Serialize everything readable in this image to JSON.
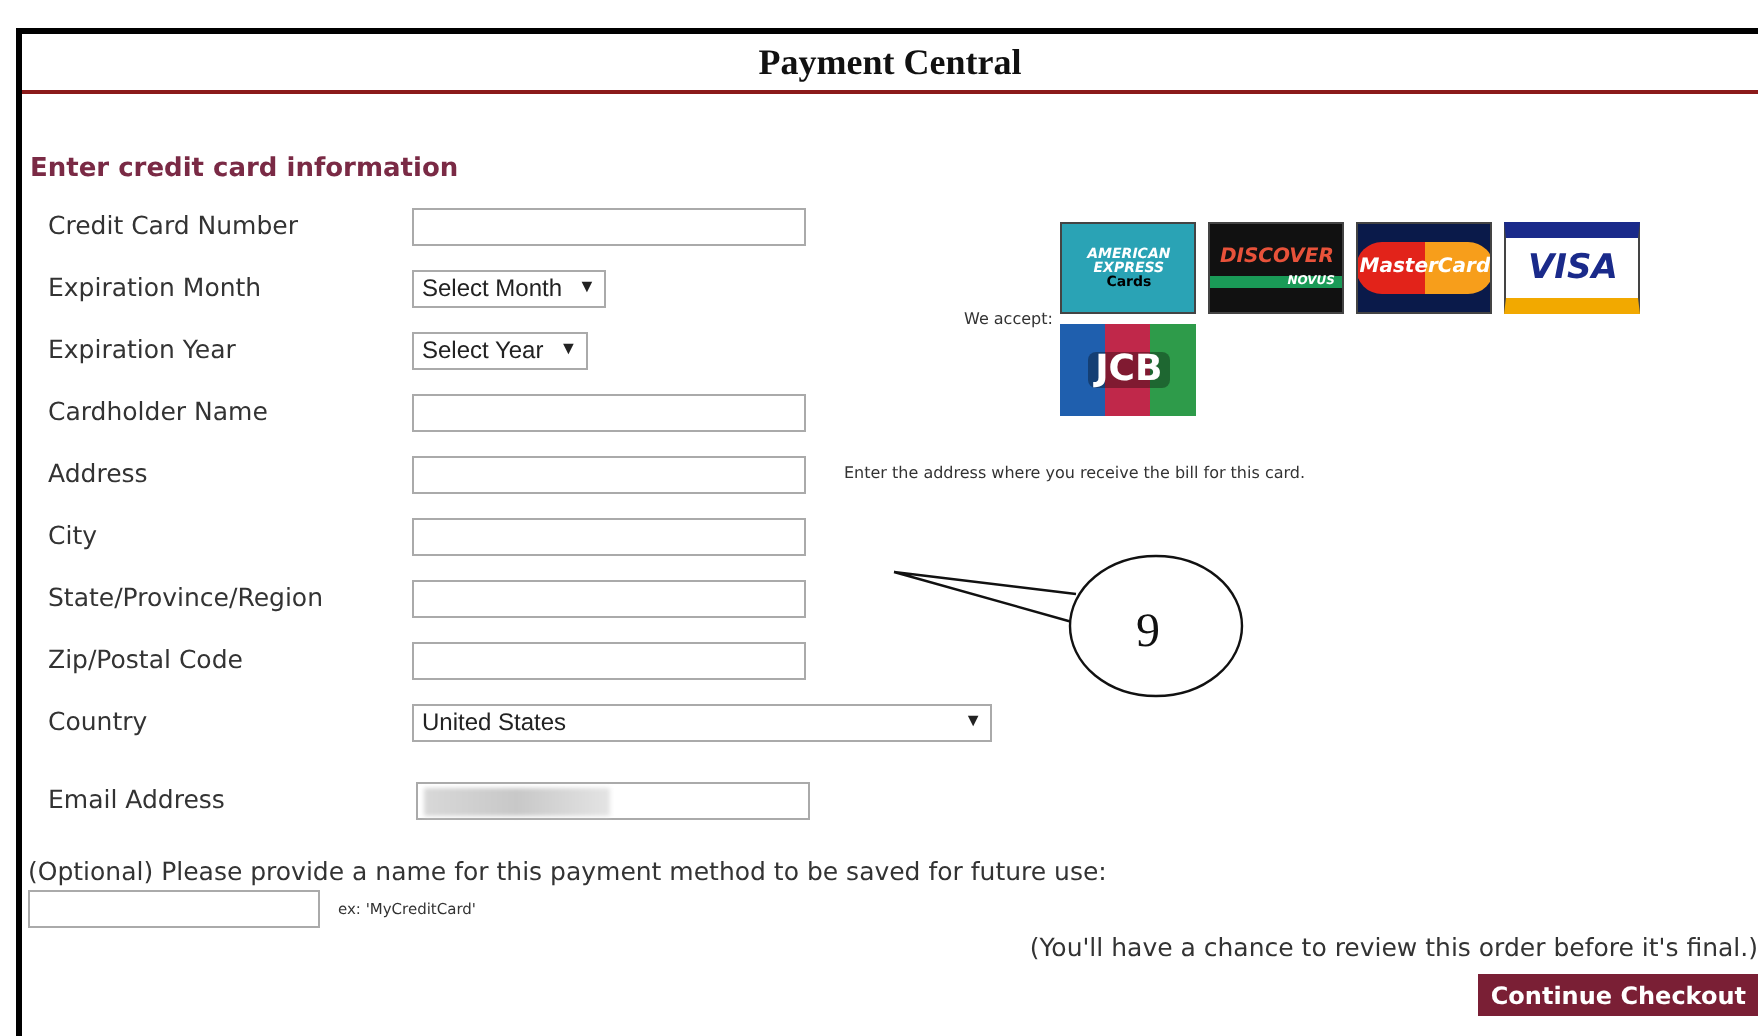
{
  "title": "Payment Central",
  "section_heading": "Enter credit card information",
  "fields": [
    {
      "label": "Credit Card Number",
      "kind": "text"
    },
    {
      "label": "Expiration Month",
      "kind": "select",
      "value": "Select Month",
      "arrow": "▼"
    },
    {
      "label": "Expiration Year",
      "kind": "select",
      "value": "Select Year",
      "arrow": "▼"
    },
    {
      "label": "Cardholder Name",
      "kind": "text"
    },
    {
      "label": "Address",
      "kind": "text",
      "hint": "Enter the address where you receive the bill for this card."
    },
    {
      "label": "City",
      "kind": "text"
    },
    {
      "label": "State/Province/Region",
      "kind": "text"
    },
    {
      "label": "Zip/Postal Code",
      "kind": "text"
    },
    {
      "label": "Country",
      "kind": "wide-select",
      "value": "United States",
      "arrow": "▼"
    }
  ],
  "email": {
    "label": "Email Address",
    "blurred": true
  },
  "accepted": {
    "label": "We accept:",
    "cards": [
      {
        "kind": "amex",
        "text": "AMERICAN EXPRESS",
        "sub": "Cards"
      },
      {
        "kind": "discover",
        "text": "DISCOVER",
        "sub": "NOVUS"
      },
      {
        "kind": "mastercard",
        "text": "MasterCard"
      },
      {
        "kind": "visa",
        "text": "VISA"
      },
      {
        "kind": "jcb",
        "text": "JCB"
      }
    ]
  },
  "save_name": {
    "prompt": "(Optional) Please provide a name for this payment method to be saved for future use:",
    "example": "ex: 'MyCreditCard'"
  },
  "review_note": "(You'll have a chance to review this order before it's final.)",
  "continue_button": "Continue Checkout",
  "callout": {
    "number": "9"
  }
}
